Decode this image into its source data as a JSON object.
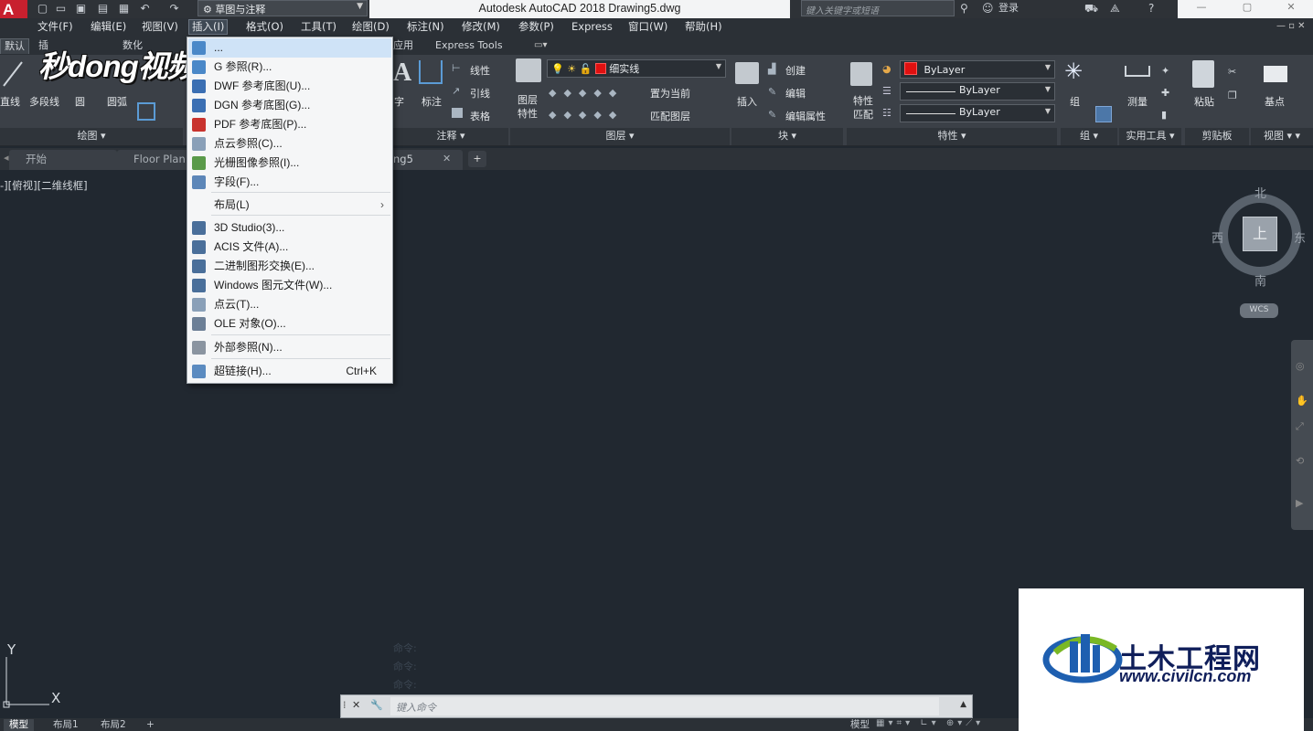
{
  "app": {
    "logo_letter": "A",
    "title": "Autodesk AutoCAD 2018    Drawing5.dwg",
    "workspace": "草图与注释",
    "search_placeholder": "键入关键字或短语",
    "login": "登录"
  },
  "menubar": [
    "文件(F)",
    "编辑(E)",
    "视图(V)",
    "插入(I)",
    "格式(O)",
    "工具(T)",
    "绘图(D)",
    "标注(N)",
    "修改(M)",
    "参数(P)",
    "Express",
    "窗口(W)",
    "帮助(H)"
  ],
  "ribbon_tabs": [
    "默认",
    "插",
    "数化",
    "应用",
    "Express Tools"
  ],
  "ribbon": {
    "draw": {
      "items": [
        "直线",
        "多段线",
        "圆",
        "圆弧"
      ],
      "footer": "绘图"
    },
    "annotate": {
      "items": [
        "字",
        "标注",
        "线性",
        "引线",
        "表格"
      ],
      "footer": "注释"
    },
    "layers": {
      "big": "图层\n特性",
      "layer_name": "细实线",
      "set_current": "置为当前",
      "match": "匹配图层",
      "footer": "图层"
    },
    "block": {
      "insert": "插入",
      "create": "创建",
      "edit": "编辑",
      "edit_attr": "编辑属性",
      "footer": "块"
    },
    "properties": {
      "match": "特性\n匹配",
      "color": "ByLayer",
      "linetype": "ByLayer",
      "lineweight": "ByLayer",
      "footer": "特性"
    },
    "group": {
      "label": "组",
      "footer": "组"
    },
    "utilities": {
      "label": "测量",
      "footer": "实用工具"
    },
    "clipboard": {
      "label": "粘贴",
      "footer": "剪贴板"
    },
    "view": {
      "label": "基点",
      "footer": "视图"
    }
  },
  "file_tabs": [
    "开始",
    "Floor Plan S",
    "ng5"
  ],
  "viewport_label": "-][俯视][二维线框]",
  "viewcube": {
    "north": "北",
    "south": "南",
    "east": "东",
    "west": "西",
    "top": "上",
    "wcs": "WCS"
  },
  "ucs": {
    "x": "X",
    "y": "Y"
  },
  "command": {
    "history": [
      "命令:",
      "命令:",
      "命令:"
    ],
    "placeholder": "键入命令"
  },
  "status_tabs": [
    "模型",
    "布局1",
    "布局2"
  ],
  "status_right": "模型",
  "insert_menu": {
    "items": [
      {
        "label": "...",
        "icon": "block-icon",
        "highlight": true
      },
      {
        "label": "G 参照(R)...",
        "icon": "dwg-ref-icon"
      },
      {
        "label": "DWF 参考底图(U)...",
        "icon": "dwf-icon"
      },
      {
        "label": "DGN 参考底图(G)...",
        "icon": "dgn-icon"
      },
      {
        "label": "PDF 参考底图(P)...",
        "icon": "pdf-icon"
      },
      {
        "label": "点云参照(C)...",
        "icon": "point-cloud-icon"
      },
      {
        "label": "光栅图像参照(I)...",
        "icon": "raster-image-icon"
      },
      {
        "label": "字段(F)...",
        "icon": "field-icon"
      },
      {
        "label": "布局(L)",
        "submenu": true
      },
      {
        "label": "3D Studio(3)...",
        "icon": "3ds-icon"
      },
      {
        "label": "ACIS 文件(A)...",
        "icon": "acis-icon"
      },
      {
        "label": "二进制图形交换(E)...",
        "icon": "dxb-icon"
      },
      {
        "label": "Windows 图元文件(W)...",
        "icon": "wmf-icon"
      },
      {
        "label": "点云(T)...",
        "icon": "point-cloud-icon"
      },
      {
        "label": "OLE 对象(O)...",
        "icon": "ole-icon"
      },
      {
        "label": "外部参照(N)...",
        "icon": "xref-icon"
      },
      {
        "label": "超链接(H)...",
        "icon": "hyperlink-icon",
        "shortcut": "Ctrl+K"
      }
    ]
  },
  "watermark_brand": "秒dong视频",
  "watermark_site": {
    "name": "土木工程网",
    "url": "www.civilcn.com"
  }
}
